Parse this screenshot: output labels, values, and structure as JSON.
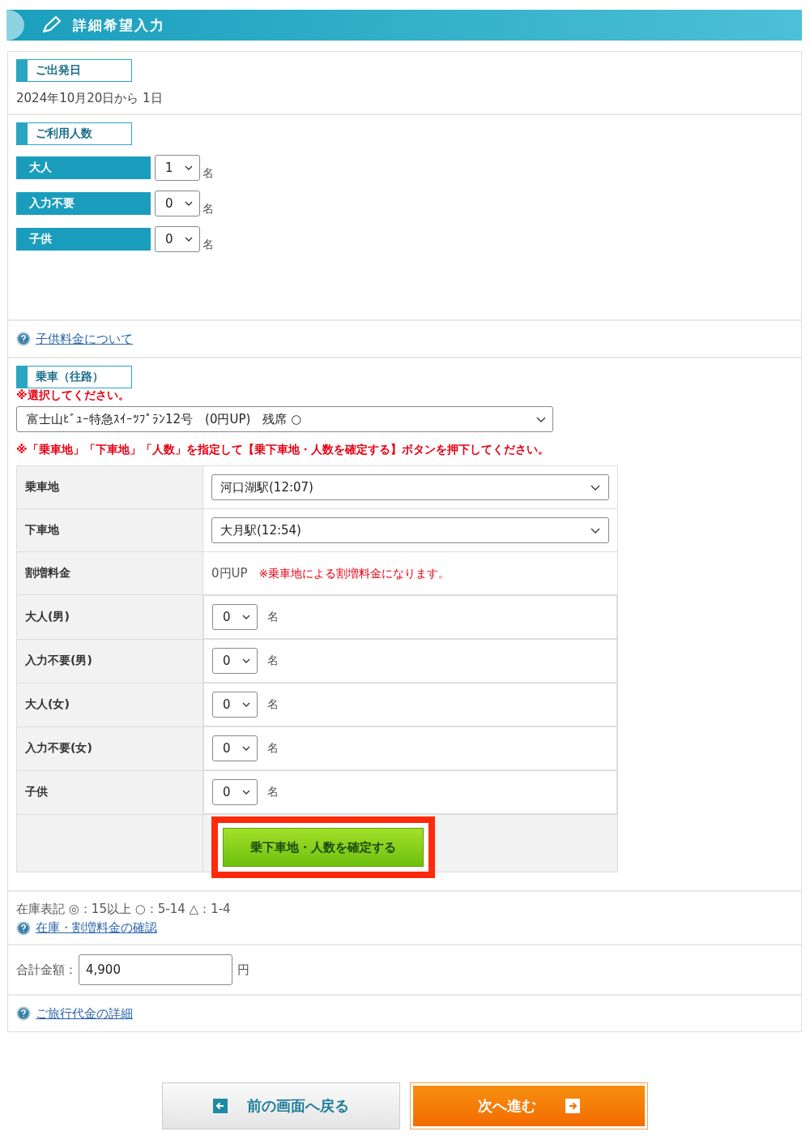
{
  "header": {
    "title": "詳細希望入力"
  },
  "departure": {
    "heading": "ご出発日",
    "text": "2024年10月20日から 1日"
  },
  "people": {
    "heading": "ご利用人数",
    "rows": [
      {
        "label": "大人",
        "value": "1",
        "unit": "名"
      },
      {
        "label": "入力不要",
        "value": "0",
        "unit": "名"
      },
      {
        "label": "子供",
        "value": "0",
        "unit": "名"
      }
    ]
  },
  "child_fare_link": "子供料金について",
  "ride": {
    "heading": "乗車（往路）",
    "prompt": "※選択してください。",
    "train": "富士山ﾋﾞｭｰ特急ｽｲｰﾂﾌﾟﾗﾝ12号　(0円UP)　残席 ○",
    "note": "※「乗車地」「下車地」「人数」を指定して【乗下車地・人数を確定する】ボタンを押下してください。",
    "rows": [
      {
        "kind": "select",
        "label": "乗車地",
        "value": "河口湖駅(12:07)"
      },
      {
        "kind": "select",
        "label": "下車地",
        "value": "大月駅(12:54)"
      },
      {
        "kind": "text",
        "label": "割増料金",
        "value": "0円UP",
        "note": "※乗車地による割増料金になります。"
      },
      {
        "kind": "count",
        "label": "大人(男)",
        "value": "0",
        "unit": "名"
      },
      {
        "kind": "count",
        "label": "入力不要(男)",
        "value": "0",
        "unit": "名"
      },
      {
        "kind": "count",
        "label": "大人(女)",
        "value": "0",
        "unit": "名"
      },
      {
        "kind": "count",
        "label": "入力不要(女)",
        "value": "0",
        "unit": "名"
      },
      {
        "kind": "count",
        "label": "子供",
        "value": "0",
        "unit": "名"
      }
    ],
    "confirm_button": "乗下車地・人数を確定する"
  },
  "stock_legend": "在庫表記 ◎：15以上 ○：5-14 △：1-4",
  "stock_link": "在庫・割増料金の確認",
  "total": {
    "label": "合計金額：",
    "value": "4,900",
    "unit": "円"
  },
  "fee_link": "ご旅行代金の詳細",
  "buttons": [
    {
      "kind": "back",
      "label": "前の画面へ戻る"
    },
    {
      "kind": "next",
      "label": "次へ進む"
    }
  ]
}
